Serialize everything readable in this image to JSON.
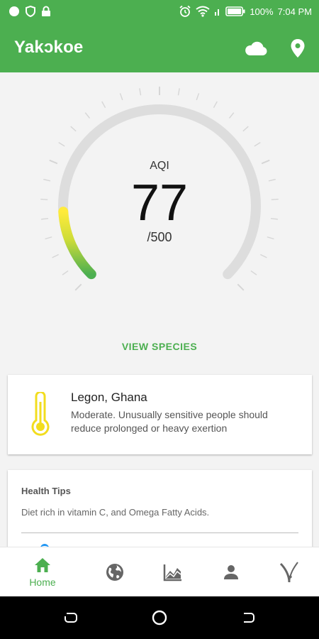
{
  "status_bar": {
    "battery_percent": "100%",
    "time": "7:04 PM"
  },
  "app_bar": {
    "title": "Yakɔkoe",
    "actions": [
      {
        "icon": "cloud-icon"
      },
      {
        "icon": "location-pin-icon"
      }
    ]
  },
  "gauge": {
    "label": "AQI",
    "value": "77",
    "max_label": "/500",
    "level_fraction": 0.154,
    "colors": {
      "track": "#dddddd",
      "low": "#4caf50",
      "mid": "#ffeb3b"
    }
  },
  "view_species_label": "VIEW SPECIES",
  "location_card": {
    "icon": "thermometer-icon",
    "icon_color": "#f2dd1e",
    "name": "Legon, Ghana",
    "description": "Moderate. Unusually sensitive people should reduce prolonged or heavy exertion"
  },
  "health_tips": {
    "title": "Health Tips",
    "tip": "Diet rich in vitamin C, and Omega Fatty Acids."
  },
  "bottom_nav": {
    "active_color": "#4caf50",
    "inactive_color": "#666666",
    "items": [
      {
        "icon": "home-icon",
        "label": "Home",
        "active": true
      },
      {
        "icon": "globe-icon",
        "active": false
      },
      {
        "icon": "chart-icon",
        "active": false
      },
      {
        "icon": "person-icon",
        "active": false
      },
      {
        "icon": "plant-icon",
        "active": false
      }
    ]
  },
  "colors": {
    "accent": "#4caf50",
    "background": "#f3f3f3"
  }
}
